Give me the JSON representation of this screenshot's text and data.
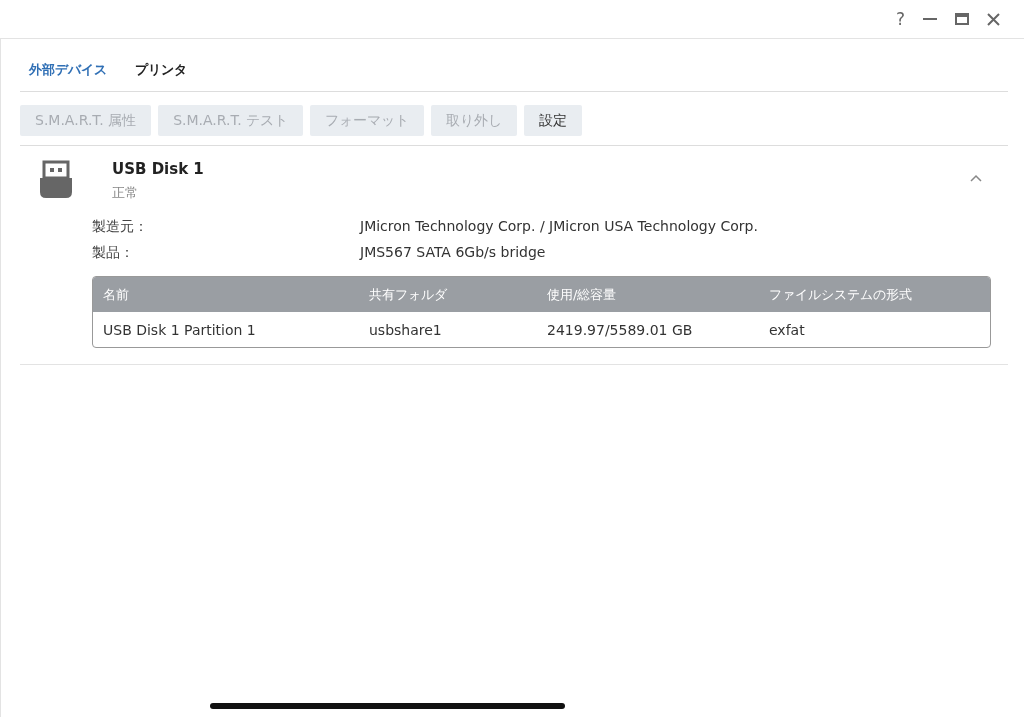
{
  "window": {
    "controls": [
      "?"
    ]
  },
  "tabs": [
    {
      "label": "外部デバイス",
      "selected": true
    },
    {
      "label": "プリンタ",
      "selected": false
    }
  ],
  "toolbar": [
    {
      "label": "S.M.A.R.T. 属性",
      "disabled": true
    },
    {
      "label": "S.M.A.R.T. テスト",
      "disabled": true
    },
    {
      "label": "フォーマット",
      "disabled": true
    },
    {
      "label": "取り外し",
      "disabled": true
    },
    {
      "label": "設定",
      "disabled": false
    }
  ],
  "device": {
    "name": "USB Disk 1",
    "status": "正常",
    "expanded": true,
    "details": [
      {
        "label": "製造元：",
        "value": "JMicron Technology Corp. / JMicron USA Technology Corp."
      },
      {
        "label": "製品：",
        "value": "JMS567 SATA 6Gb/s bridge"
      }
    ],
    "table": {
      "columns": [
        "名前",
        "共有フォルダ",
        "使用/総容量",
        "ファイルシステムの形式"
      ],
      "rows": [
        [
          "USB Disk 1 Partition 1",
          "usbshare1",
          "2419.97/5589.01 GB",
          "exfat"
        ]
      ]
    }
  }
}
